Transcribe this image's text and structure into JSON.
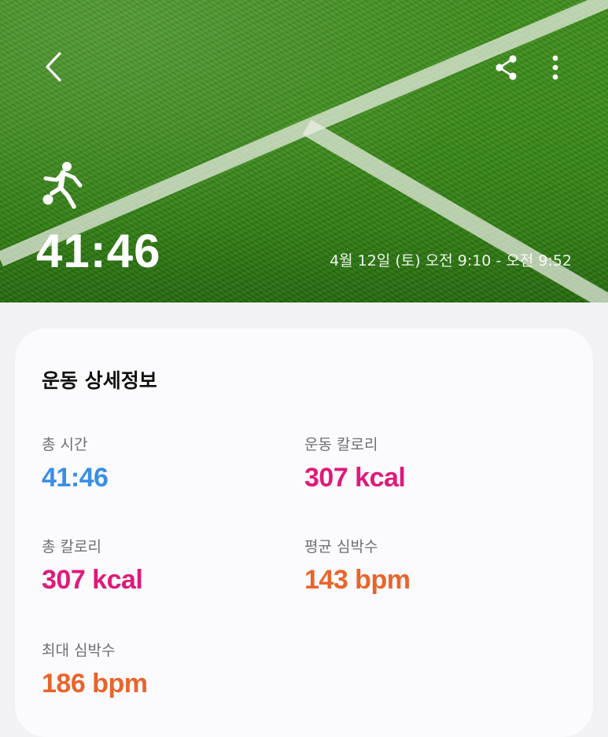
{
  "header": {
    "back_icon": "chevron-left-icon",
    "share_icon": "share-icon",
    "more_icon": "more-vertical-icon",
    "activity_icon": "soccer-player-icon",
    "duration": "41:46",
    "date_range": "4월 12일 (토) 오전 9:10 - 오전 9:52"
  },
  "details": {
    "title": "운동 상세정보",
    "stats": [
      {
        "label": "총 시간",
        "value": "41:46",
        "color": "#3a8ee6"
      },
      {
        "label": "운동 칼로리",
        "value": "307 kcal",
        "color": "#e0197a"
      },
      {
        "label": "총 칼로리",
        "value": "307 kcal",
        "color": "#e0197a"
      },
      {
        "label": "평균 심박수",
        "value": "143 bpm",
        "color": "#e9642b"
      },
      {
        "label": "최대 심박수",
        "value": "186 bpm",
        "color": "#e9642b"
      }
    ]
  }
}
